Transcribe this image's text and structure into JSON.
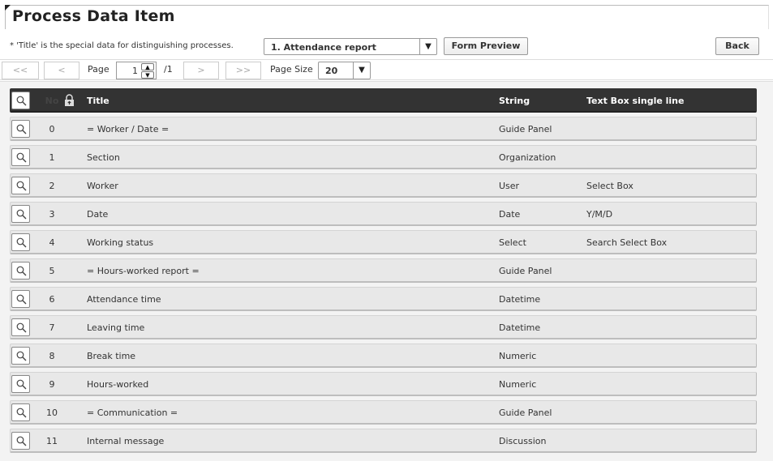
{
  "page": {
    "title": "Process Data Item"
  },
  "toolbar": {
    "note": "* 'Title' is the special data for distinguishing processes.",
    "process_select": {
      "value": "1. Attendance report"
    },
    "form_preview_label": "Form Preview",
    "back_label": "Back"
  },
  "pager": {
    "first": "<<",
    "prev": "<",
    "page_label": "Page",
    "current_page": "1",
    "total_pages": "/1",
    "next": ">",
    "last": ">>",
    "page_size_label": "Page Size",
    "page_size_value": "20"
  },
  "header": {
    "no": "No",
    "title": "Title",
    "type": "String",
    "input": "Text Box single line"
  },
  "rows": [
    {
      "no": "0",
      "title": "= Worker / Date =",
      "type": "Guide Panel",
      "input": ""
    },
    {
      "no": "1",
      "title": "Section",
      "type": "Organization",
      "input": ""
    },
    {
      "no": "2",
      "title": "Worker",
      "type": "User",
      "input": "Select Box"
    },
    {
      "no": "3",
      "title": "Date",
      "type": "Date",
      "input": "Y/M/D"
    },
    {
      "no": "4",
      "title": "Working status",
      "type": "Select",
      "input": "Search Select Box"
    },
    {
      "no": "5",
      "title": "= Hours-worked report =",
      "type": "Guide Panel",
      "input": ""
    },
    {
      "no": "6",
      "title": "Attendance time",
      "type": "Datetime",
      "input": ""
    },
    {
      "no": "7",
      "title": "Leaving time",
      "type": "Datetime",
      "input": ""
    },
    {
      "no": "8",
      "title": "Break time",
      "type": "Numeric",
      "input": ""
    },
    {
      "no": "9",
      "title": "Hours-worked",
      "type": "Numeric",
      "input": ""
    },
    {
      "no": "10",
      "title": "= Communication =",
      "type": "Guide Panel",
      "input": ""
    },
    {
      "no": "11",
      "title": "Internal message",
      "type": "Discussion",
      "input": ""
    }
  ]
}
